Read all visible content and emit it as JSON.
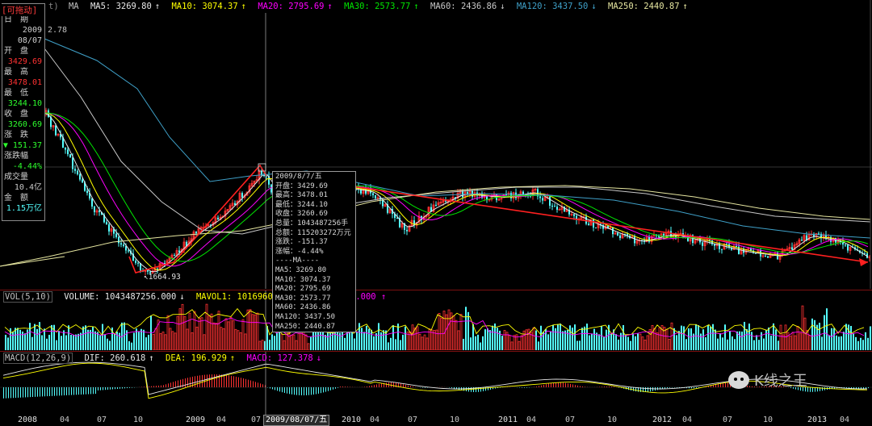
{
  "colors": {
    "up": "#ff3232",
    "down": "#54ffff",
    "ma5": "#e8e8e8",
    "ma10": "#ffff00",
    "ma20": "#ff00ff",
    "ma30": "#00e600",
    "ma60": "#c8c8c8",
    "ma120": "#3fa0c8",
    "ma250": "#e6e6a0",
    "trend": "#ff2020"
  },
  "main_header": {
    "drag_label": "[可拖动]",
    "symbol_suffix": "t)",
    "ma_label": "MA",
    "ma5": "MA5: 3269.80",
    "ma10": "MA10: 3074.37",
    "ma20": "MA20: 2795.69",
    "ma30": "MA30: 2573.77",
    "ma60": "MA60: 2436.86",
    "ma60_arrow": "↓",
    "ma120": "MA120: 3437.50",
    "ma120_arrow": "↓",
    "ma250": "MA250: 2440.87",
    "ma250_arrow": "↑",
    "up_arrow": "↑"
  },
  "side_info": {
    "date_label": "日　期",
    "date_val1": "2009",
    "date_val2": "08/07",
    "open_label": "开　盘",
    "open_val": "3429.69",
    "high_label": "最　高",
    "high_val": "3478.01",
    "low_label": "最　低",
    "low_val": "3244.10",
    "close_label": "收　盘",
    "close_val": "3260.69",
    "change_label": "涨　跌",
    "change_val": "▼ 151.37",
    "pct_label": "涨跌幅",
    "pct_val": "-4.44%",
    "volume_label": "成交量",
    "volume_val": "10.4亿",
    "amount_label": "金　额",
    "amount_val": "1.15万亿",
    "top_price": "2.78"
  },
  "low_marker": "1664.93",
  "tooltip": {
    "date": "2009/8/7/五",
    "open": "开盘：3429.69",
    "high": "最高：3478.01",
    "low": "最低：3244.10",
    "close": "收盘：3260.69",
    "total_vol": "总量：1043487256手",
    "total_amt": "总额：115203272万元",
    "change": "涨跌：-151.37",
    "pct": "涨幅：-4.44%",
    "ma_title": "----MA----",
    "ma5": "MA5：3269.80",
    "ma10": "MA10：3074.37",
    "ma20": "MA20：2795.69",
    "ma30": "MA30：2573.77",
    "ma60": "MA60：2436.86",
    "ma120": "MA120：3437.50",
    "ma250": "MA250：2440.87"
  },
  "vol_header": {
    "label": "VOL(5,10)",
    "volume": "VOLUME: 1043487256.000",
    "volume_arrow": "↓",
    "mavol1": "MAVOL1: 1016960977.800",
    "mavol1_arrow": "↑",
    "mavol2_tail": "5.000",
    "mavol2_arrow": "↑"
  },
  "macd_header": {
    "label": "MACD(12,26,9)",
    "dif": "DIF: 260.618",
    "dif_arrow": "↑",
    "dea": "DEA: 196.929",
    "dea_arrow": "↑",
    "macd": "MACD: 127.378",
    "macd_arrow": "↓"
  },
  "watermark": "K线之王",
  "date_axis": {
    "labels": [
      "2008",
      "04",
      "07",
      "10",
      "2009",
      "04",
      "07",
      "10",
      "2010",
      "04",
      "07",
      "10",
      "2011",
      "04",
      "07",
      "10",
      "2012",
      "04",
      "07",
      "10",
      "2013",
      "04"
    ],
    "cursor_date": "2009/08/07/五"
  }
}
